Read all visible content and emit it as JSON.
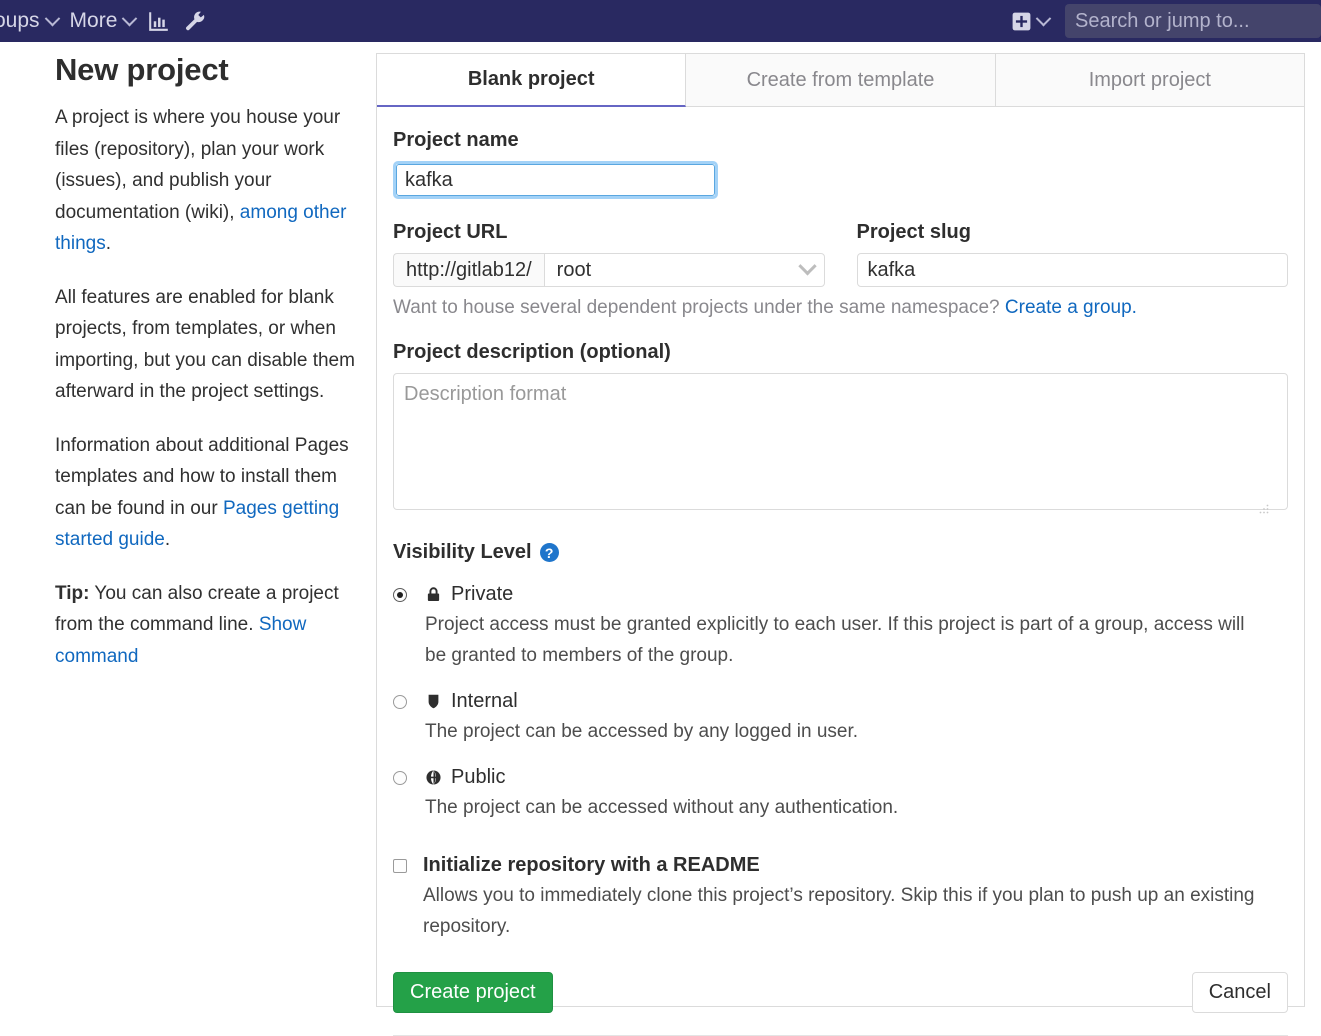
{
  "navbar": {
    "items": [
      {
        "label": "oups",
        "icon": "chevron-down-icon",
        "truncated": true
      },
      {
        "label": "More",
        "icon": "chevron-down-icon",
        "truncated": false
      }
    ],
    "analytics_icon": "bar-chart-icon",
    "admin_icon": "wrench-icon",
    "plus_icon": "plus-square-icon",
    "plus_caret_icon": "chevron-down-icon",
    "search": {
      "placeholder": "Search or jump to...",
      "value": ""
    }
  },
  "left": {
    "title": "New project",
    "p1_before": "A project is where you house your files (repository), plan your work (issues), and publish your documentation (wiki), ",
    "p1_link": "among other things",
    "p1_after": ".",
    "p2": "All features are enabled for blank projects, from templates, or when importing, but you can disable them afterward in the project settings.",
    "p3_before": "Information about additional Pages templates and how to install them can be found in our ",
    "p3_link": "Pages getting started guide",
    "p3_after": ".",
    "tip_label": "Tip:",
    "tip_text": " You can also create a project from the command line. ",
    "tip_link": "Show command"
  },
  "panel": {
    "tabs": [
      {
        "label": "Blank project",
        "active": true
      },
      {
        "label": "Create from template",
        "active": false
      },
      {
        "label": "Import project",
        "active": false
      }
    ],
    "project_name": {
      "label": "Project name",
      "value": "kafka",
      "placeholder": ""
    },
    "project_url": {
      "label": "Project URL",
      "prefix": "http://gitlab12/",
      "namespace": "root",
      "chevron_icon": "chevron-down-icon"
    },
    "project_slug": {
      "label": "Project slug",
      "value": "kafka",
      "placeholder": ""
    },
    "namespace_hint": {
      "text": "Want to house several dependent projects under the same namespace? ",
      "link": "Create a group."
    },
    "description": {
      "label": "Project description (optional)",
      "placeholder": "Description format",
      "value": ""
    },
    "visibility": {
      "label": "Visibility Level",
      "help_icon": "question-circle-icon",
      "options": [
        {
          "id": "private",
          "icon": "lock-icon",
          "title": "Private",
          "description": "Project access must be granted explicitly to each user. If this project is part of a group, access will be granted to members of the group.",
          "selected": true
        },
        {
          "id": "internal",
          "icon": "shield-icon",
          "title": "Internal",
          "description": "The project can be accessed by any logged in user.",
          "selected": false
        },
        {
          "id": "public",
          "icon": "globe-icon",
          "title": "Public",
          "description": "The project can be accessed without any authentication.",
          "selected": false
        }
      ]
    },
    "readme": {
      "title": "Initialize repository with a README",
      "description": "Allows you to immediately clone this project’s repository. Skip this if you plan to push up an existing repository.",
      "checked": false
    },
    "actions": {
      "submit_label": "Create project",
      "cancel_label": "Cancel"
    }
  },
  "colors": {
    "navbar_bg": "#292961",
    "accent": "#6666c4",
    "link": "#1068bf",
    "success": "#24a148",
    "help_blue": "#1f75cb",
    "focus_ring": "#a3d2f7"
  }
}
